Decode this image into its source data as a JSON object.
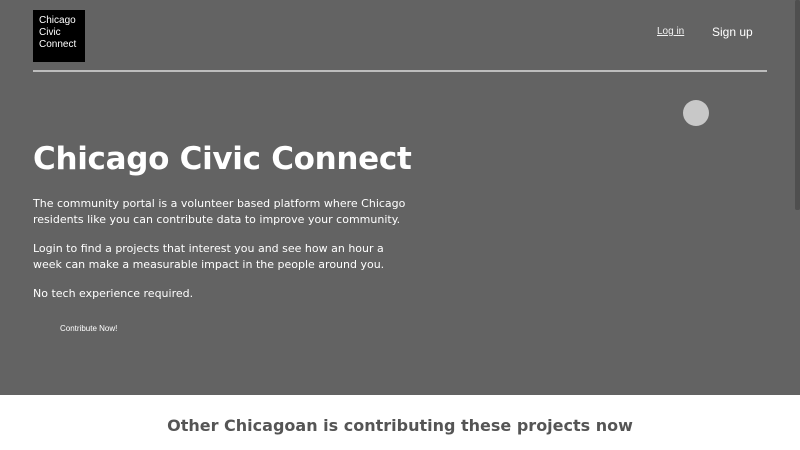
{
  "header": {
    "logo_lines": [
      "Chicago",
      "Civic",
      "Connect"
    ],
    "login_label": "Log in",
    "signup_label": "Sign up"
  },
  "hero": {
    "title": "Chicago Civic Connect",
    "paragraph1": "The community portal is a volunteer based platform where Chicago residents like you can contribute data to improve your community.",
    "paragraph2": "Login to find a projects that interest you and see how an hour a week can make a measurable impact in the people around you.",
    "paragraph3": "No tech experience required.",
    "cta_label": "Contribute Now!"
  },
  "section": {
    "heading": "Other Chicagoan is  contributing these projects now"
  },
  "colors": {
    "hero_background": "#636363",
    "logo_background": "#000000",
    "text_light": "#ffffff",
    "section_text": "#555555"
  }
}
